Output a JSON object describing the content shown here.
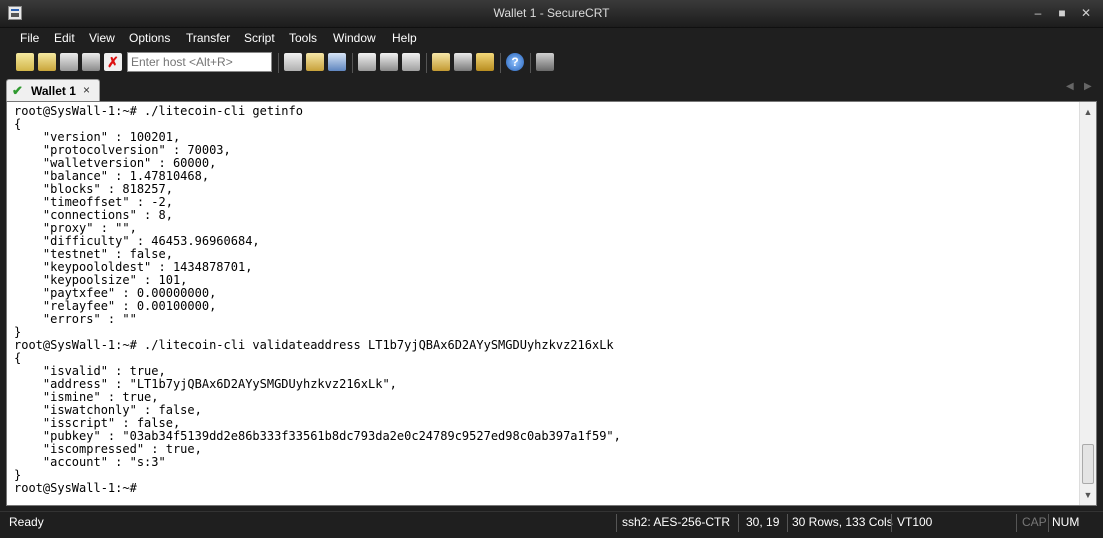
{
  "window": {
    "title": "Wallet 1 - SecureCRT"
  },
  "menu": [
    "File",
    "Edit",
    "View",
    "Options",
    "Transfer",
    "Script",
    "Tools",
    "Window",
    "Help"
  ],
  "toolbar": {
    "host_placeholder": "Enter host <Alt+R>"
  },
  "tabs": [
    {
      "label": "Wallet 1",
      "close": "×"
    }
  ],
  "terminal": {
    "lines": [
      "root@SysWall-1:~# ./litecoin-cli getinfo",
      "{",
      "    \"version\" : 100201,",
      "    \"protocolversion\" : 70003,",
      "    \"walletversion\" : 60000,",
      "    \"balance\" : 1.47810468,",
      "    \"blocks\" : 818257,",
      "    \"timeoffset\" : -2,",
      "    \"connections\" : 8,",
      "    \"proxy\" : \"\",",
      "    \"difficulty\" : 46453.96960684,",
      "    \"testnet\" : false,",
      "    \"keypoololdest\" : 1434878701,",
      "    \"keypoolsize\" : 101,",
      "    \"paytxfee\" : 0.00000000,",
      "    \"relayfee\" : 0.00100000,",
      "    \"errors\" : \"\"",
      "}",
      "root@SysWall-1:~# ./litecoin-cli validateaddress LT1b7yjQBAx6D2AYySMGDUyhzkvz216xLk",
      "{",
      "    \"isvalid\" : true,",
      "    \"address\" : \"LT1b7yjQBAx6D2AYySMGDUyhzkvz216xLk\",",
      "    \"ismine\" : true,",
      "    \"iswatchonly\" : false,",
      "    \"isscript\" : false,",
      "    \"pubkey\" : \"03ab34f5139dd2e86b333f33561b8dc793da2e0c24789c9527ed98c0ab397a1f59\",",
      "    \"iscompressed\" : true,",
      "    \"account\" : \"s:3\"",
      "}",
      "root@SysWall-1:~#"
    ]
  },
  "status": {
    "ready": "Ready",
    "protocol": "ssh2: AES-256-CTR",
    "cursor": "30, 19",
    "size": "30 Rows, 133 Cols",
    "emulation": "VT100",
    "cap": "CAP",
    "num": "NUM"
  }
}
